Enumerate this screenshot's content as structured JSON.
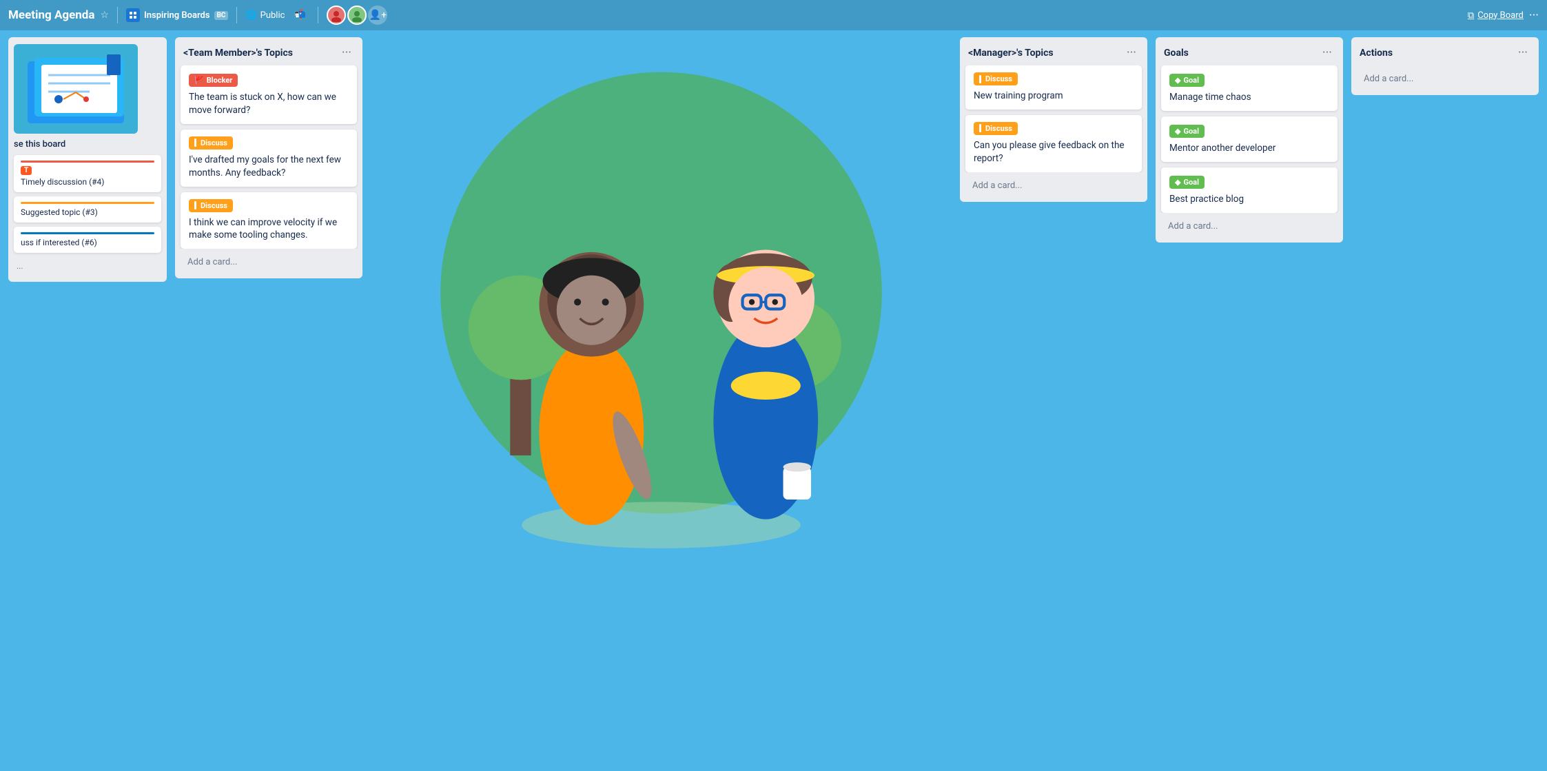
{
  "header": {
    "title": "Meeting Agenda",
    "star_icon": "☆",
    "workspace_name": "Inspiring Boards",
    "workspace_badge": "BC",
    "visibility": "Public",
    "copy_board_label": "Copy Board",
    "more_icon": "···"
  },
  "sidebar": {
    "use_board_text": "se this board",
    "items": [
      {
        "bar_color": "bar-red",
        "label": "",
        "tag_label": "",
        "text": "Timely discussion (#4)"
      },
      {
        "bar_color": "bar-orange",
        "label": "",
        "text": "Suggested topic (#3)"
      },
      {
        "bar_color": "bar-blue",
        "label": "",
        "text": "uss if interested (#6)"
      }
    ],
    "add_placeholder": "..."
  },
  "lists": [
    {
      "id": "team-member",
      "title": "<Team Member>'s Topics",
      "cards": [
        {
          "label": "Blocker",
          "label_color": "label-red",
          "label_icon": "🚩",
          "text": "The team is stuck on X, how can we move forward?"
        },
        {
          "label": "Discuss",
          "label_color": "label-orange",
          "label_icon": "",
          "text": "I've drafted my goals for the next few months. Any feedback?"
        },
        {
          "label": "Discuss",
          "label_color": "label-orange",
          "label_icon": "",
          "text": "I think we can improve velocity if we make some tooling changes."
        }
      ],
      "add_card_label": "Add a card..."
    },
    {
      "id": "manager",
      "title": "<Manager>'s Topics",
      "cards": [
        {
          "label": "Discuss",
          "label_color": "label-orange",
          "label_icon": "",
          "text": "New training program"
        },
        {
          "label": "Discuss",
          "label_color": "label-orange",
          "label_icon": "",
          "text": "Can you please give feedback on the report?"
        }
      ],
      "add_card_label": "Add a card..."
    },
    {
      "id": "goals",
      "title": "Goals",
      "cards": [
        {
          "label": "Goal",
          "label_color": "label-green",
          "label_icon": "◆",
          "text": "Manage time chaos"
        },
        {
          "label": "Goal",
          "label_color": "label-green",
          "label_icon": "◆",
          "text": "Mentor another developer"
        },
        {
          "label": "Goal",
          "label_color": "label-green",
          "label_icon": "◆",
          "text": "Best practice blog"
        }
      ],
      "add_card_label": "Add a card..."
    },
    {
      "id": "actions",
      "title": "Actions",
      "cards": [],
      "add_card_label": "Add a card..."
    }
  ]
}
